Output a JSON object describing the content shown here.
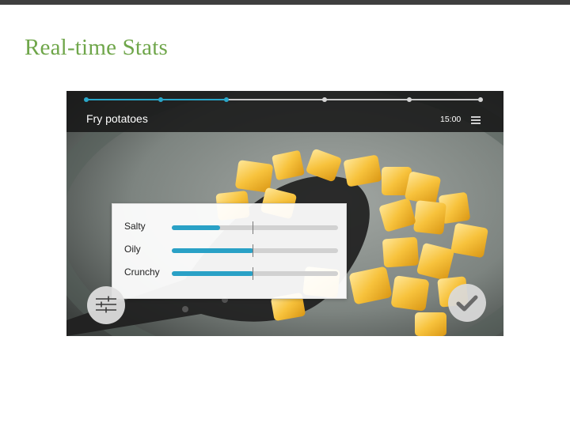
{
  "slide": {
    "title": "Real-time Stats"
  },
  "app": {
    "step_title": "Fry potatoes",
    "timer": "15:00",
    "progress": {
      "total_steps": 6,
      "current_step": 3
    },
    "accent_color": "#2aa1c6",
    "menu_icon": "hamburger-menu-icon",
    "stats": [
      {
        "label": "Salty",
        "level": 0.29
      },
      {
        "label": "Oily",
        "level": 0.49
      },
      {
        "label": "Crunchy",
        "level": 0.49
      }
    ],
    "buttons": {
      "settings_icon": "sliders-icon",
      "confirm_icon": "checkmark-icon"
    }
  }
}
